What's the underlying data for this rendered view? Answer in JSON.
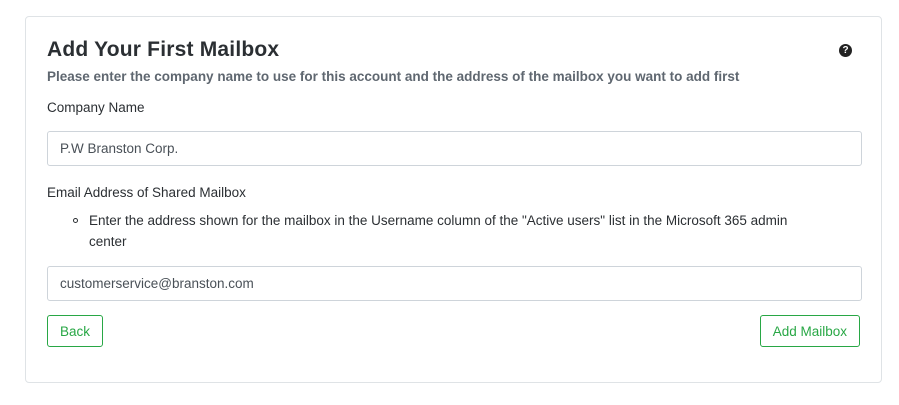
{
  "form": {
    "title": "Add Your First Mailbox",
    "help_icon_name": "question-circle-icon",
    "subtitle": "Please enter the company name to use for this account and the address of the mailbox you want to add first",
    "company_label": "Company Name",
    "company_value": "P.W Branston Corp.",
    "email_label": "Email Address of Shared Mailbox",
    "email_hint": "Enter the address shown for the mailbox in the Username column of the \"Active users\" list in the Microsoft 365 admin center",
    "email_value": "customerservice@branston.com",
    "back_label": "Back",
    "add_label": "Add Mailbox"
  },
  "colors": {
    "accent": "#28a745",
    "border": "#ced4da",
    "text": "#212529",
    "muted": "#5f6770"
  }
}
